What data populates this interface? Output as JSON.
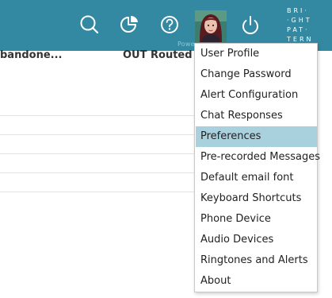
{
  "header": {
    "powered_text": "Powe",
    "logo_lines": [
      "BRI·",
      "·GHT",
      "PAT·",
      "TERN"
    ],
    "icons": [
      "search-icon",
      "chart-icon",
      "help-icon",
      "avatar",
      "power-icon"
    ],
    "bar_color": "#3389a2"
  },
  "table": {
    "columns": [
      "bandone...",
      "OUT Routed"
    ]
  },
  "menu": {
    "selected_index": 4,
    "selected_color": "#a9d0dd",
    "items": [
      {
        "label": "User Profile"
      },
      {
        "label": "Change Password"
      },
      {
        "label": "Alert Configuration"
      },
      {
        "label": "Chat Responses"
      },
      {
        "label": "Preferences"
      },
      {
        "label": "Pre-recorded Messages"
      },
      {
        "label": "Default email font"
      },
      {
        "label": "Keyboard Shortcuts"
      },
      {
        "label": "Phone Device"
      },
      {
        "label": "Audio Devices"
      },
      {
        "label": "Ringtones and Alerts"
      },
      {
        "label": "About"
      }
    ]
  }
}
